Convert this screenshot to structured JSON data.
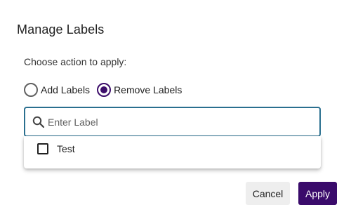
{
  "dialog": {
    "title": "Manage Labels",
    "prompt": "Choose action to apply:",
    "actions": [
      {
        "label": "Add Labels",
        "checked": false
      },
      {
        "label": "Remove Labels",
        "checked": true
      }
    ],
    "search": {
      "placeholder": "Enter Label",
      "value": "",
      "icon": "search-icon"
    },
    "options": [
      {
        "label": "Test",
        "checked": false
      }
    ],
    "buttons": {
      "cancel": "Cancel",
      "apply": "Apply"
    }
  },
  "colors": {
    "accent": "#3a0b6b",
    "focus_border": "#2a6f8f",
    "cancel_bg": "#eeeeee"
  }
}
